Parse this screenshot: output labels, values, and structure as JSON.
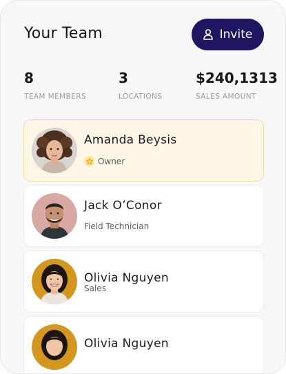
{
  "header": {
    "title": "Your Team",
    "invite_label": "Invite"
  },
  "stats": [
    {
      "value": "8",
      "label": "TEAM MEMBERS"
    },
    {
      "value": "3",
      "label": "LOCATIONS"
    },
    {
      "value": "$240,1313",
      "label": "SALES AMOUNT"
    }
  ],
  "members": [
    {
      "name": "Amanda Beysis",
      "role": "Owner",
      "badge_icon": "star-icon"
    },
    {
      "name": "Jack O’Conor",
      "role": "Field Technician"
    },
    {
      "name": "Olivia Nguyen",
      "role": "Sales"
    },
    {
      "name": "Olivia Nguyen",
      "role": ""
    }
  ],
  "colors": {
    "primary": "#1e1660",
    "owner_bg": "#fff6e6",
    "owner_border": "#f5d9a3",
    "muted_label": "#9a9aa6"
  }
}
